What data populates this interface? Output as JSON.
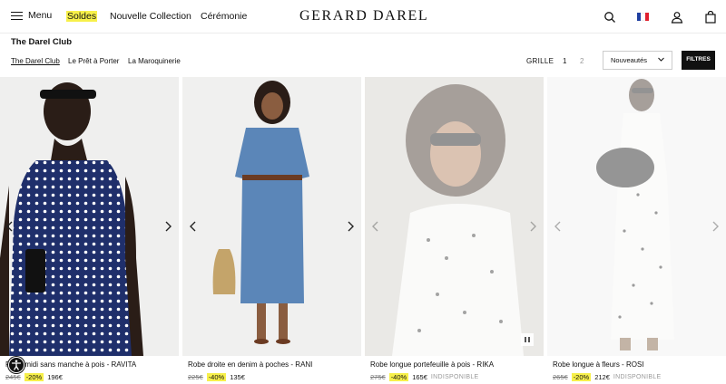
{
  "header": {
    "menu_label": "Menu",
    "nav": [
      "Soldes",
      "Nouvelle Collection",
      "Cérémonie"
    ],
    "logo": "GERARD DAREL",
    "icons": [
      "search-icon",
      "flag-fr-icon",
      "user-icon",
      "bag-icon"
    ]
  },
  "subheader": {
    "title": "The Darel Club",
    "tabs": [
      "The Darel Club",
      "Le Prêt à Porter",
      "La Maroquinerie"
    ],
    "grid_label": "GRILLE",
    "grid_options": [
      "1",
      "2"
    ],
    "sort_value": "Nouveautés",
    "filters_label": "FILTRES"
  },
  "products": [
    {
      "name": "Robe midi sans manche à pois - RAVITA",
      "old_price": "245€",
      "discount": "-20%",
      "price": "196€",
      "status": ""
    },
    {
      "name": "Robe droite en denim à poches - RANI",
      "old_price": "225€",
      "discount": "-40%",
      "price": "135€",
      "status": ""
    },
    {
      "name": "Robe longue portefeuille à pois - RIKA",
      "old_price": "275€",
      "discount": "-40%",
      "price": "165€",
      "status": "INDISPONIBLE"
    },
    {
      "name": "Robe longue à fleurs - ROSI",
      "old_price": "265€",
      "discount": "-20%",
      "price": "212€",
      "status": "INDISPONIBLE"
    }
  ],
  "colors": {
    "accent_yellow": "#f7f04a",
    "dark": "#111111"
  }
}
